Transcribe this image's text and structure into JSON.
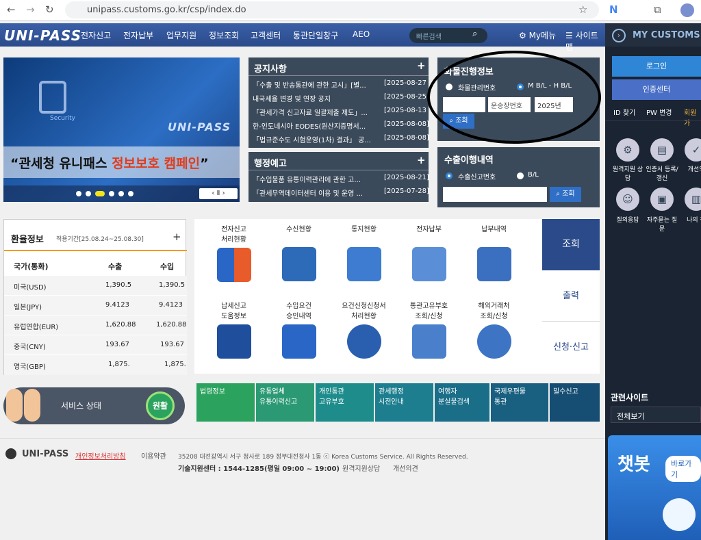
{
  "browser": {
    "url": "unipass.customs.go.kr/csp/index.do"
  },
  "header": {
    "logo": "UNI-PASS",
    "nav": [
      "전자신고",
      "전자납부",
      "업무지원",
      "정보조회",
      "고객센터",
      "통관단일창구",
      "AEO"
    ],
    "search_placeholder": "빠른검색",
    "mymenu": "My메뉴",
    "sitemap": "사이트맵"
  },
  "right": {
    "title": "MY CUSTOMS",
    "login": "로그인",
    "cert": "인증센터",
    "links": [
      "ID 찾기",
      "PW 변경",
      "회원가"
    ],
    "icons": [
      "원격지원 상담",
      "인증서 등록/갱신",
      "개선의",
      "질의응답",
      "자주묻는 질문",
      "나의 챗"
    ],
    "related_title": "관련사이트",
    "related_select": "전체보기",
    "chatbot": "챗봇",
    "chatbot_btn": "바로가기"
  },
  "banner": {
    "caption_a": "“관세청 유니패스 ",
    "caption_b": "정보보호 캠페인",
    "caption_c": "”",
    "logo": "UNI-PASS",
    "security": "Security"
  },
  "notice": {
    "title": "공지사항",
    "items": [
      [
        "「수출 및 반송통관에 관한 고시」[별...",
        "[2025-08-27"
      ],
      [
        "내국세율 변경 및 연장 공지",
        "[2025-08-25"
      ],
      [
        "「관세가격 신고자료 일괄제출 제도」...",
        "[2025-08-13"
      ],
      [
        "한-인도네시아 EODES(원산지증명서...",
        "[2025-08-08]"
      ],
      [
        "「법규준수도 시험운영(1차) 결과」 공...",
        "[2025-08-08]"
      ]
    ]
  },
  "admin": {
    "title": "행정예고",
    "items": [
      [
        "「수입물품 유통이력관리에 관한 고...",
        "[2025-08-21]"
      ],
      [
        "「관세무역데이터센터 이용 및 운영 ...",
        "[2025-07-28]"
      ]
    ]
  },
  "cargo": {
    "title": "화물진행정보",
    "opt1": "화물관리번호",
    "opt2": "M B/L - H B/L",
    "input2": "운송장번호",
    "year": "2025년",
    "btn": "조회"
  },
  "export": {
    "title": "수출이행내역",
    "opt1": "수출신고번호",
    "opt2": "B/L",
    "btn": "조회"
  },
  "exchange": {
    "title": "환율정보",
    "period": "적용기간[25.08.24~25.08.30]",
    "headers": [
      "국가(통화)",
      "수출",
      "수입"
    ],
    "rows": [
      [
        "미국(USD)",
        "1,390.5",
        "1,390.5"
      ],
      [
        "일본(JPY)",
        "9.4123",
        "9.4123"
      ],
      [
        "유럽연합(EUR)",
        "1,620.88",
        "1,620.88"
      ],
      [
        "중국(CNY)",
        "193.67",
        "193.67"
      ],
      [
        "영국(GBP)",
        "1,875.",
        "1,875."
      ]
    ]
  },
  "tiles": [
    [
      "전자신고",
      "처리현황"
    ],
    [
      "수신현황",
      ""
    ],
    [
      "통지현황",
      ""
    ],
    [
      "전자납부",
      ""
    ],
    [
      "납부내역",
      ""
    ],
    [
      "납세신고",
      "도움정보"
    ],
    [
      "수입요건",
      "승인내역"
    ],
    [
      "요건신청신청서",
      "처리현황"
    ],
    [
      "통관고유부호",
      "조회/신청"
    ],
    [
      "해외거래처",
      "조회/신청"
    ]
  ],
  "side_tabs": [
    "조회",
    "출력",
    "신청·신고"
  ],
  "status": {
    "label": "서비스 상태",
    "value": "원활"
  },
  "bands": [
    [
      "법령정보",
      ""
    ],
    [
      "유통업체",
      "유통이력신고"
    ],
    [
      "개인통관",
      "고유부호"
    ],
    [
      "관세행정",
      "시전안내"
    ],
    [
      "여행자",
      "분실물검색"
    ],
    [
      "국제우편물",
      "통관"
    ],
    [
      "밀수신고",
      ""
    ]
  ],
  "footer": {
    "logo": "UNI-PASS",
    "privacy": "개인정보처리방침",
    "terms": "이용약관",
    "address": "35208 대전광역시 서구 청사로 189 정부대전청사 1동 ⓒ Korea Customs Service. All Rights Reserved.",
    "support": "기술지원센터 : 1544-1285(평일 09:00 ~ 19:00)",
    "remote": "원격지원상담",
    "improve": "개선의견"
  },
  "colors": {
    "nav": "#2a4a8a",
    "panel": "#3b4a5a",
    "accent": "#f59a1a",
    "right": "#1a2433",
    "teal": "#1f8c8c",
    "green": "#2ba35f"
  }
}
